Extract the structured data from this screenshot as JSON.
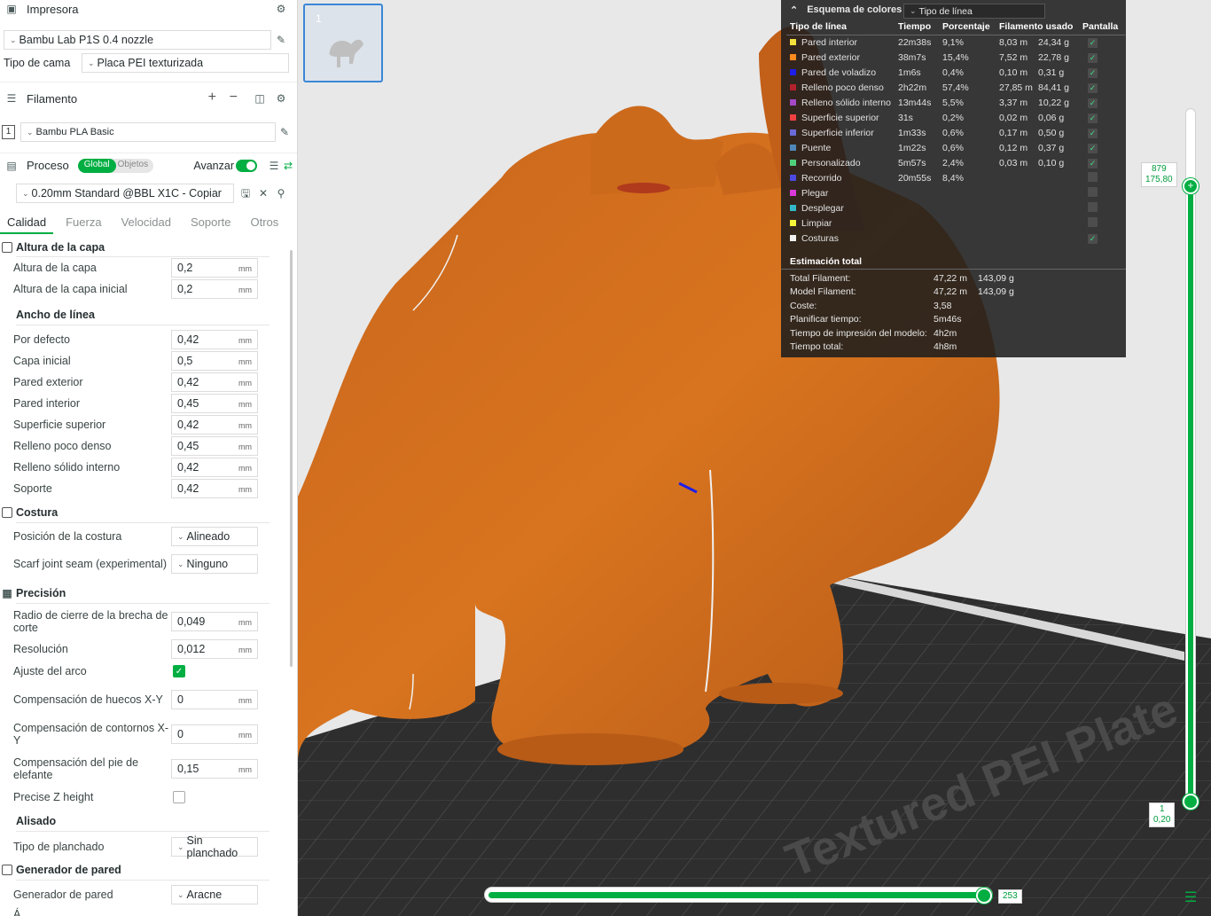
{
  "printer": {
    "title": "Impresora",
    "model": "Bambu Lab P1S 0.4 nozzle",
    "bed_label": "Tipo de cama",
    "bed_value": "Placa PEI texturizada"
  },
  "filament": {
    "title": "Filamento",
    "slot": "1",
    "value": "Bambu PLA Basic"
  },
  "process": {
    "title": "Proceso",
    "toggle_global": "Global",
    "toggle_objects": "Objetos",
    "advanced_label": "Avanzar",
    "preset": "0.20mm Standard @BBL X1C - Copiar"
  },
  "tabs": [
    "Calidad",
    "Fuerza",
    "Velocidad",
    "Soporte",
    "Otros"
  ],
  "groups": {
    "layer_height": {
      "title": "Altura de la capa",
      "items": [
        {
          "label": "Altura de la capa",
          "value": "0,2",
          "unit": "mm"
        },
        {
          "label": "Altura de la capa inicial",
          "value": "0,2",
          "unit": "mm"
        }
      ]
    },
    "line_width": {
      "title": "Ancho de línea",
      "items": [
        {
          "label": "Por defecto",
          "value": "0,42",
          "unit": "mm"
        },
        {
          "label": "Capa inicial",
          "value": "0,5",
          "unit": "mm"
        },
        {
          "label": "Pared exterior",
          "value": "0,42",
          "unit": "mm"
        },
        {
          "label": "Pared interior",
          "value": "0,45",
          "unit": "mm"
        },
        {
          "label": "Superficie superior",
          "value": "0,42",
          "unit": "mm"
        },
        {
          "label": "Relleno poco denso",
          "value": "0,45",
          "unit": "mm"
        },
        {
          "label": "Relleno sólido interno",
          "value": "0,42",
          "unit": "mm"
        },
        {
          "label": "Soporte",
          "value": "0,42",
          "unit": "mm"
        }
      ]
    },
    "seam": {
      "title": "Costura",
      "position_label": "Posición de la costura",
      "position_value": "Alineado",
      "scarf_label": "Scarf joint seam (experimental)",
      "scarf_value": "Ninguno"
    },
    "precision": {
      "title": "Precisión",
      "gap_label": "Radio de cierre de la brecha de corte",
      "gap_value": "0,049",
      "resolution_label": "Resolución",
      "resolution_value": "0,012",
      "arc_label": "Ajuste del arco",
      "xy_hole_label": "Compensación de huecos X-Y",
      "xy_hole_value": "0",
      "xy_contour_label": "Compensación de contornos X-Y",
      "xy_contour_value": "0",
      "elephant_label": "Compensación del pie de elefante",
      "elephant_value": "0,15",
      "precise_z_label": "Precise Z height",
      "unit": "mm"
    },
    "ironing": {
      "title": "Alisado",
      "type_label": "Tipo de planchado",
      "type_value": "Sin planchado"
    },
    "wall_gen": {
      "title": "Generador de pared",
      "label": "Generador de pared",
      "value": "Aracne",
      "partial": "Á... "
    }
  },
  "thumbnail": {
    "plate": "1"
  },
  "legend": {
    "title": "Esquema de colores",
    "select": "Tipo de línea",
    "headers": [
      "Tipo de línea",
      "Tiempo",
      "Porcentaje",
      "Filamento usado",
      "Pantalla"
    ],
    "rows": [
      {
        "name": "Pared interior",
        "color": "#f5e13b",
        "time": "22m38s",
        "pct": "9,1%",
        "len": "8,03 m",
        "wt": "24,34 g",
        "shown": true
      },
      {
        "name": "Pared exterior",
        "color": "#ff8a1f",
        "time": "38m7s",
        "pct": "15,4%",
        "len": "7,52 m",
        "wt": "22,78 g",
        "shown": true
      },
      {
        "name": "Pared de voladizo",
        "color": "#1e1ee6",
        "time": "1m6s",
        "pct": "0,4%",
        "len": "0,10 m",
        "wt": "0,31 g",
        "shown": true
      },
      {
        "name": "Relleno poco denso",
        "color": "#b3212c",
        "time": "2h22m",
        "pct": "57,4%",
        "len": "27,85 m",
        "wt": "84,41 g",
        "shown": true
      },
      {
        "name": "Relleno sólido interno",
        "color": "#a548c8",
        "time": "13m44s",
        "pct": "5,5%",
        "len": "3,37 m",
        "wt": "10,22 g",
        "shown": true
      },
      {
        "name": "Superficie superior",
        "color": "#f04040",
        "time": "31s",
        "pct": "0,2%",
        "len": "0,02 m",
        "wt": "0,06 g",
        "shown": true
      },
      {
        "name": "Superficie inferior",
        "color": "#6a6ad8",
        "time": "1m33s",
        "pct": "0,6%",
        "len": "0,17 m",
        "wt": "0,50 g",
        "shown": true
      },
      {
        "name": "Puente",
        "color": "#4f86b8",
        "time": "1m22s",
        "pct": "0,6%",
        "len": "0,12 m",
        "wt": "0,37 g",
        "shown": true
      },
      {
        "name": "Personalizado",
        "color": "#4fd07a",
        "time": "5m57s",
        "pct": "2,4%",
        "len": "0,03 m",
        "wt": "0,10 g",
        "shown": true
      },
      {
        "name": "Recorrido",
        "color": "#4a4ae0",
        "time": "20m55s",
        "pct": "8,4%",
        "len": "",
        "wt": "",
        "shown": false
      },
      {
        "name": "Plegar",
        "color": "#d93ad9",
        "time": "",
        "pct": "",
        "len": "",
        "wt": "",
        "shown": false
      },
      {
        "name": "Desplegar",
        "color": "#32b8c8",
        "time": "",
        "pct": "",
        "len": "",
        "wt": "",
        "shown": false
      },
      {
        "name": "Limpiar",
        "color": "#f5f53a",
        "time": "",
        "pct": "",
        "len": "",
        "wt": "",
        "shown": false
      },
      {
        "name": "Costuras",
        "color": "#f0f0f0",
        "time": "",
        "pct": "",
        "len": "",
        "wt": "",
        "shown": true
      }
    ],
    "totals_title": "Estimación total",
    "totals": [
      {
        "k": "Total Filament:",
        "v1": "47,22 m",
        "v2": "143,09 g"
      },
      {
        "k": "Model Filament:",
        "v1": "47,22 m",
        "v2": "143,09 g"
      },
      {
        "k": "Coste:",
        "v1": "3,58",
        "v2": ""
      },
      {
        "k": "Planificar tiempo:",
        "v1": "5m46s",
        "v2": ""
      },
      {
        "k": "Tiempo de impresión del modelo:",
        "v1": "4h2m",
        "v2": ""
      },
      {
        "k": "Tiempo total:",
        "v1": "4h8m",
        "v2": ""
      }
    ]
  },
  "vslider": {
    "top_layer": "879",
    "top_height": "175,80",
    "bottom_layer": "1",
    "bottom_height": "0,20"
  },
  "hslider": {
    "value": "253"
  },
  "plate_text": "Textured PEI Plate",
  "colors": {
    "accent": "#00ae42",
    "model": "#d2691e",
    "bed": "#2e2e2e"
  }
}
